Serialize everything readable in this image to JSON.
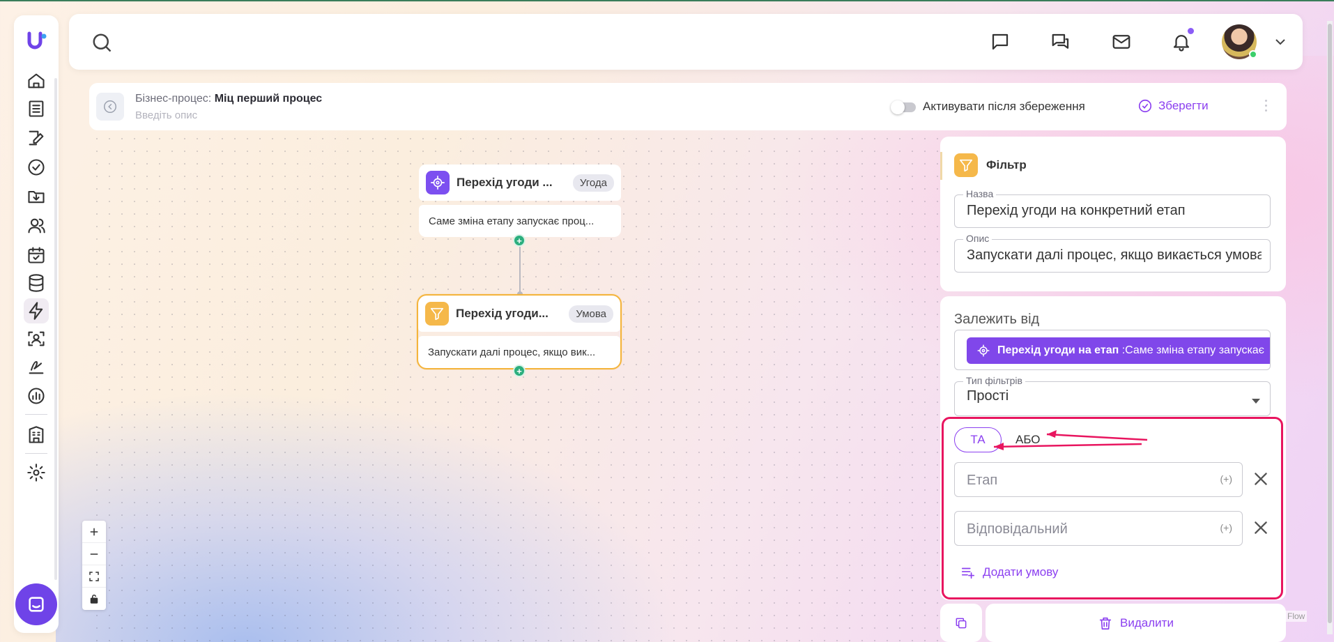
{
  "process": {
    "label": "Бізнес-процес:",
    "name": "Міц перший процес",
    "description_placeholder": "Введіть опис",
    "activate_label": "Активувати після збереження",
    "save_label": "Зберегти"
  },
  "nodes": [
    {
      "title": "Перехід угоди ...",
      "badge": "Угода",
      "description": "Саме зміна етапу запускає проц...",
      "icon": "target-icon",
      "color": "#7c4ff0"
    },
    {
      "title": "Перехід угоди...",
      "badge": "Умова",
      "description": "Запускати далі процес, якщо вик...",
      "icon": "filter-icon",
      "color": "#f5b84a"
    }
  ],
  "panel": {
    "title": "Фільтр",
    "name_label": "Назва",
    "name_value": "Перехід угоди на конкретний етап",
    "desc_label": "Опис",
    "desc_value": "Запускати далі процес, якщо викається умова",
    "depends_label": "Залежить від",
    "depends_chip_bold": "Перехід угоди на етап",
    "depends_chip_rest": ":Саме зміна етапу запускає",
    "filter_type_label": "Тип фільтрів",
    "filter_type_value": "Прості",
    "logic_and": "ТА",
    "logic_or": "АБО",
    "conditions": [
      {
        "placeholder": "Етап",
        "plus": "(+)"
      },
      {
        "placeholder": "Відповідальний",
        "plus": "(+)"
      }
    ],
    "add_condition_label": "Додати умову",
    "delete_label": "Видалити"
  },
  "flow_attribution": "Flow",
  "colors": {
    "accent": "#8b3ff0",
    "highlight": "#e8155f",
    "node_selected": "#f4b43c",
    "handle": "#2cae7e"
  }
}
